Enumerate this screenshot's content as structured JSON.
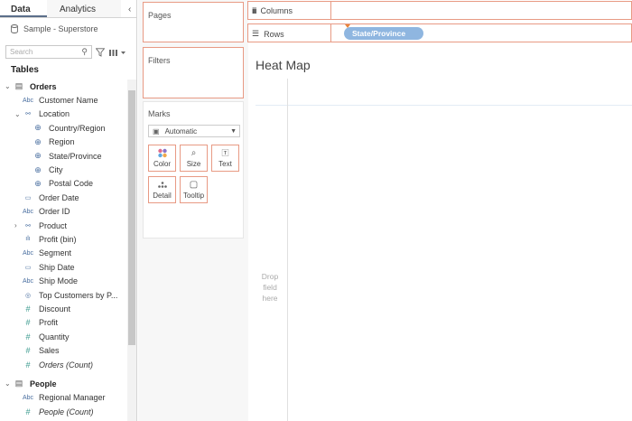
{
  "tabs": {
    "data": "Data",
    "analytics": "Analytics"
  },
  "datasource": "Sample - Superstore",
  "search_placeholder": "Search",
  "tables_heading": "Tables",
  "fields": [
    {
      "label": "Orders",
      "icon": "table-icon",
      "glyph": "▤",
      "indent": 0,
      "style": "bold",
      "arrow": "⌄"
    },
    {
      "label": "Customer Name",
      "icon": "abc-icon",
      "glyph": "Abc",
      "indent": 1
    },
    {
      "label": "Location",
      "icon": "hierarchy-icon",
      "glyph": "⚯",
      "indent": 1,
      "arrow": "⌄"
    },
    {
      "label": "Country/Region",
      "icon": "globe-icon",
      "glyph": "⊕",
      "indent": 2
    },
    {
      "label": "Region",
      "icon": "globe-icon",
      "glyph": "⊕",
      "indent": 2
    },
    {
      "label": "State/Province",
      "icon": "globe-icon",
      "glyph": "⊕",
      "indent": 2
    },
    {
      "label": "City",
      "icon": "globe-icon",
      "glyph": "⊕",
      "indent": 2
    },
    {
      "label": "Postal Code",
      "icon": "globe-icon",
      "glyph": "⊕",
      "indent": 2
    },
    {
      "label": "Order Date",
      "icon": "calendar-icon",
      "glyph": "▭",
      "indent": 1
    },
    {
      "label": "Order ID",
      "icon": "abc-icon",
      "glyph": "Abc",
      "indent": 1
    },
    {
      "label": "Product",
      "icon": "hierarchy-icon",
      "glyph": "⚯",
      "indent": 1,
      "arrow": "›"
    },
    {
      "label": "Profit (bin)",
      "icon": "bin-icon",
      "glyph": "ılı",
      "indent": 1
    },
    {
      "label": "Segment",
      "icon": "abc-icon",
      "glyph": "Abc",
      "indent": 1
    },
    {
      "label": "Ship Date",
      "icon": "calendar-icon",
      "glyph": "▭",
      "indent": 1
    },
    {
      "label": "Ship Mode",
      "icon": "abc-icon",
      "glyph": "Abc",
      "indent": 1
    },
    {
      "label": "Top Customers by P...",
      "icon": "set-icon",
      "glyph": "◎",
      "indent": 1
    },
    {
      "label": "Discount",
      "icon": "measure-icon",
      "glyph": "#",
      "indent": 1
    },
    {
      "label": "Profit",
      "icon": "measure-icon",
      "glyph": "#",
      "indent": 1
    },
    {
      "label": "Quantity",
      "icon": "measure-icon",
      "glyph": "#",
      "indent": 1
    },
    {
      "label": "Sales",
      "icon": "measure-icon",
      "glyph": "#",
      "indent": 1
    },
    {
      "label": "Orders (Count)",
      "icon": "measure-icon",
      "glyph": "#",
      "indent": 1,
      "style": "ital"
    },
    {
      "label": "",
      "icon": "",
      "glyph": "",
      "indent": 0,
      "spacer": true
    },
    {
      "label": "People",
      "icon": "table-icon",
      "glyph": "▤",
      "indent": 0,
      "style": "bold",
      "arrow": "⌄"
    },
    {
      "label": "Regional Manager",
      "icon": "abc-icon",
      "glyph": "Abc",
      "indent": 1
    },
    {
      "label": "People (Count)",
      "icon": "measure-icon",
      "glyph": "#",
      "indent": 1,
      "style": "ital"
    }
  ],
  "cards": {
    "pages": "Pages",
    "filters": "Filters",
    "marks": "Marks"
  },
  "marks": {
    "type": "Automatic",
    "buttons": {
      "color": "Color",
      "size": "Size",
      "text": "Text",
      "detail": "Detail",
      "tooltip": "Tooltip"
    }
  },
  "shelves": {
    "columns": "Columns",
    "rows": "Rows",
    "rows_pill": "State/Province"
  },
  "view": {
    "title": "Heat Map",
    "drop_text": "Drop field here"
  },
  "colors": {
    "accent": "#e89a84",
    "pill": "#8fb6e0",
    "field_icon": "#4a6fa0"
  }
}
